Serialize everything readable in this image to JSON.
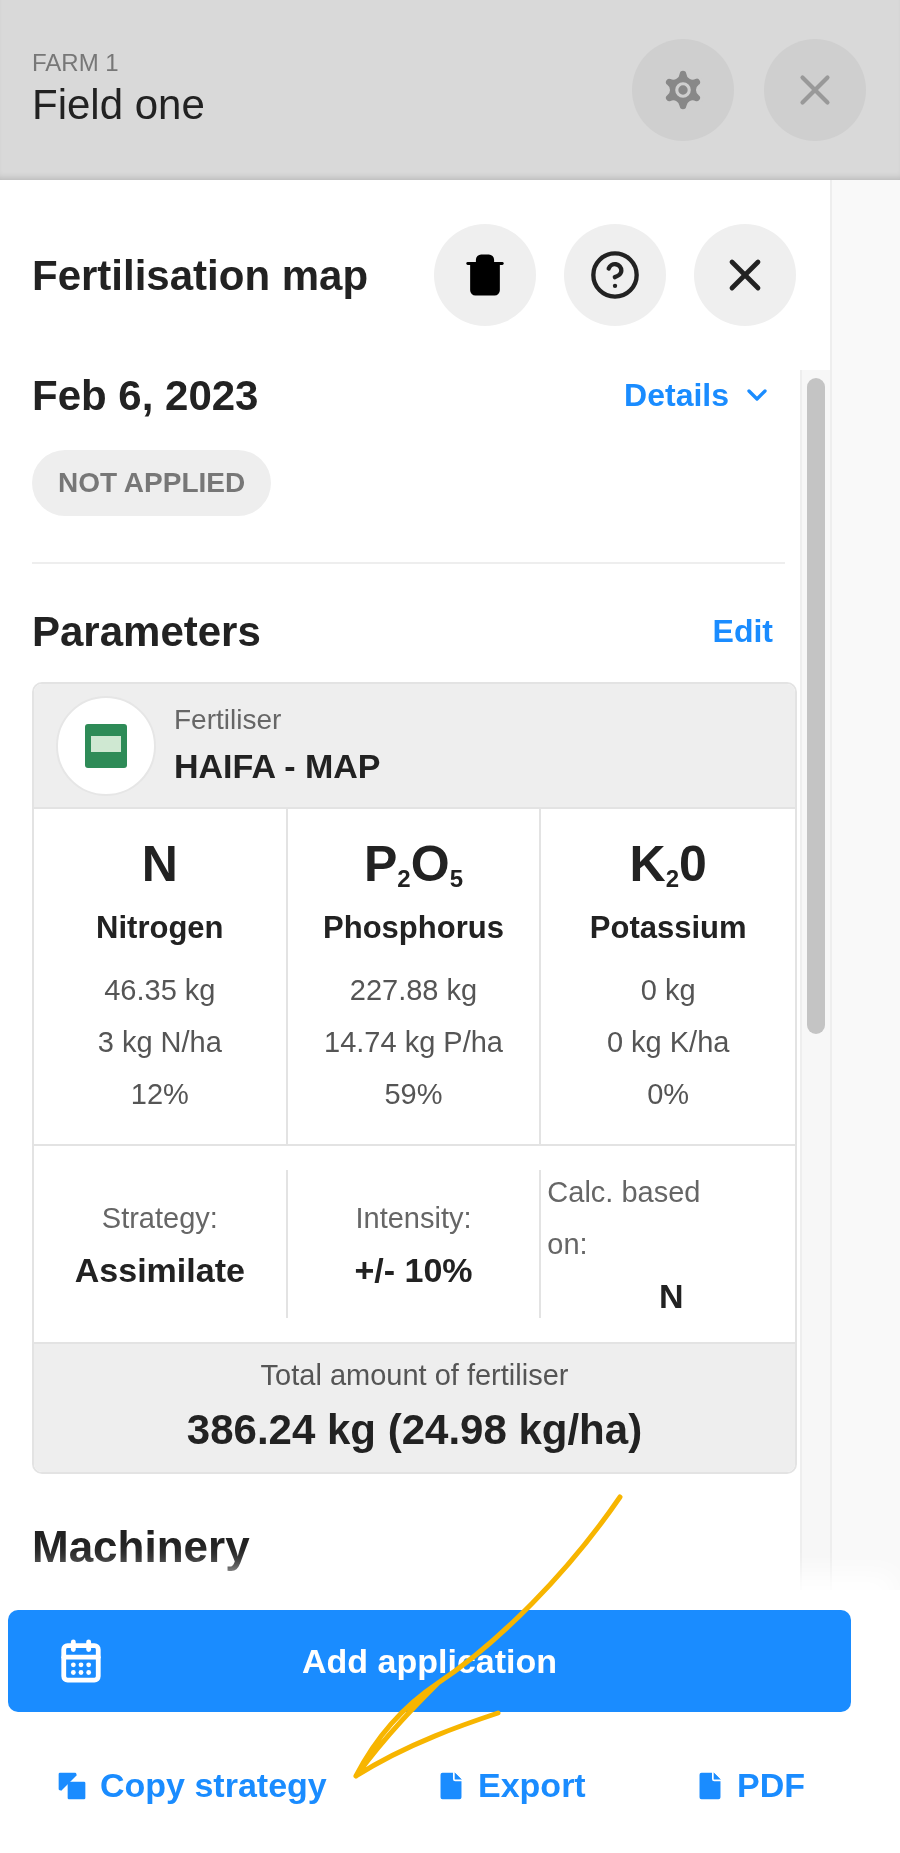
{
  "header": {
    "subtitle": "FARM 1",
    "title": "Field one"
  },
  "panel": {
    "title": "Fertilisation map"
  },
  "application": {
    "date": "Feb 6, 2023",
    "details_link": "Details",
    "status": "NOT APPLIED"
  },
  "parameters": {
    "title": "Parameters",
    "edit_link": "Edit",
    "fertiliser": {
      "label": "Fertiliser",
      "name": "HAIFA - MAP"
    },
    "nutrients": [
      {
        "formula": "N",
        "name": "Nitrogen",
        "amount": "46.35 kg",
        "rate": "3 kg N/ha",
        "share": "12%"
      },
      {
        "formula": "P$_{2}$O$_{5}$",
        "name": "Phosphorus",
        "amount": "227.88 kg",
        "rate": "14.74 kg P/ha",
        "share": "59%"
      },
      {
        "formula": "K$_{2}$0",
        "name": "Potassium",
        "amount": "0 kg",
        "rate": "0 kg K/ha",
        "share": "0%"
      }
    ],
    "settings": [
      {
        "kind": "centered",
        "label": "Strategy:",
        "value": "Assimilate"
      },
      {
        "kind": "centered",
        "label": "Intensity:",
        "value": "+/- 10%"
      },
      {
        "kind": "wrapped",
        "label": "Calc. based on:",
        "value": "N"
      }
    ],
    "total": {
      "label": "Total amount of fertiliser",
      "value": "386.24 kg (24.98 kg/ha)"
    }
  },
  "machinery": {
    "title": "Machinery"
  },
  "actions": {
    "primary": "Add application",
    "links": [
      {
        "kind": "copy",
        "label": "Copy strategy"
      },
      {
        "kind": "file",
        "label": "Export"
      },
      {
        "kind": "file",
        "label": "PDF"
      }
    ]
  }
}
